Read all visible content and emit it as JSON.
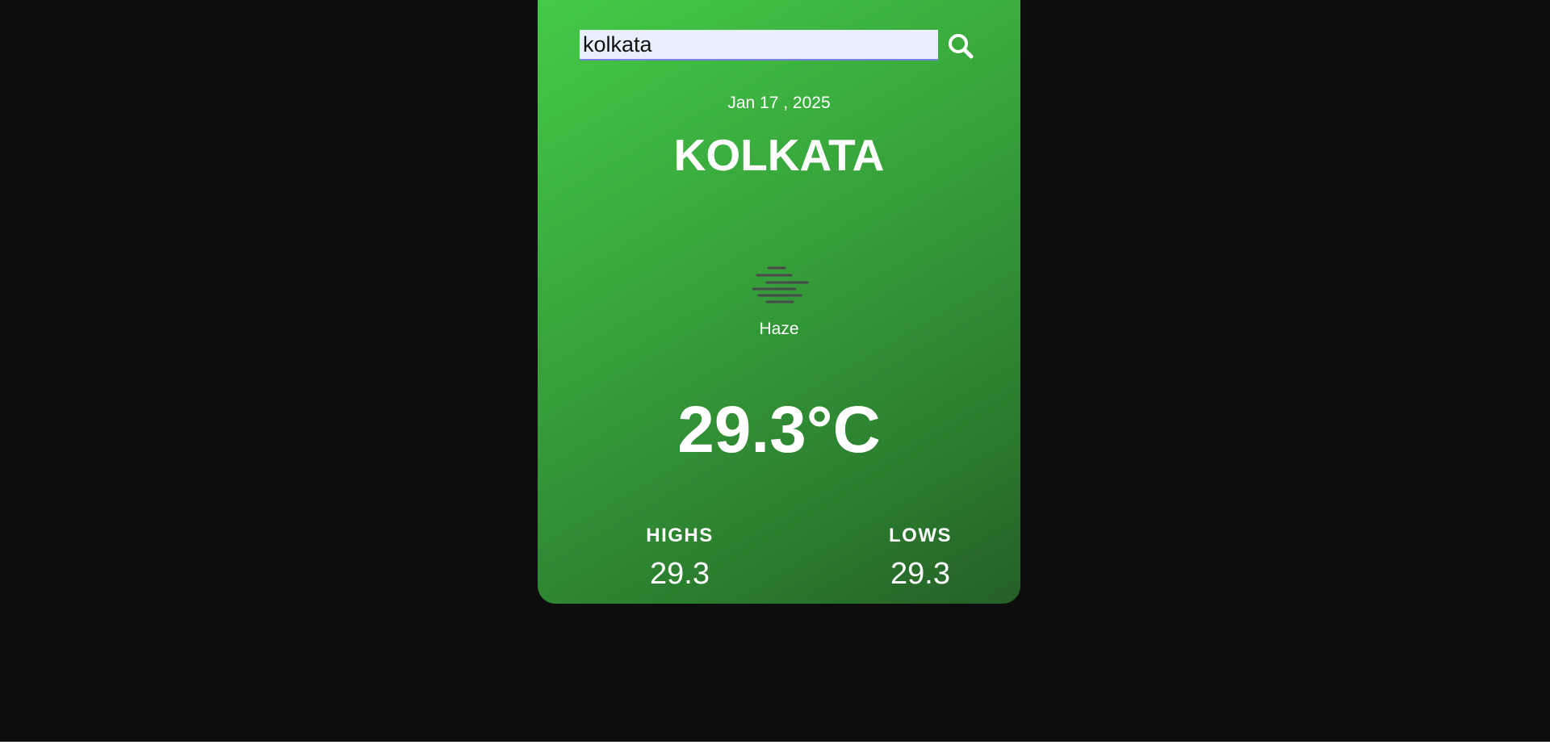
{
  "search": {
    "value": "kolkata",
    "icon": "search-icon"
  },
  "weather": {
    "date": "Jan 17 , 2025",
    "city": "KOLKATA",
    "condition_icon": "haze-icon",
    "condition": "Haze",
    "temperature": "29.3°C",
    "highs_label": "HIGHS",
    "highs_value": "29.3",
    "lows_label": "LOWS",
    "lows_value": "29.3"
  },
  "colors": {
    "background": "#0d0d0d",
    "card_gradient_start": "#45cc48",
    "card_gradient_end": "#255f27",
    "text": "#ffffff",
    "input_background": "#e8f0fe",
    "haze_icon": "#4a4a4a"
  }
}
